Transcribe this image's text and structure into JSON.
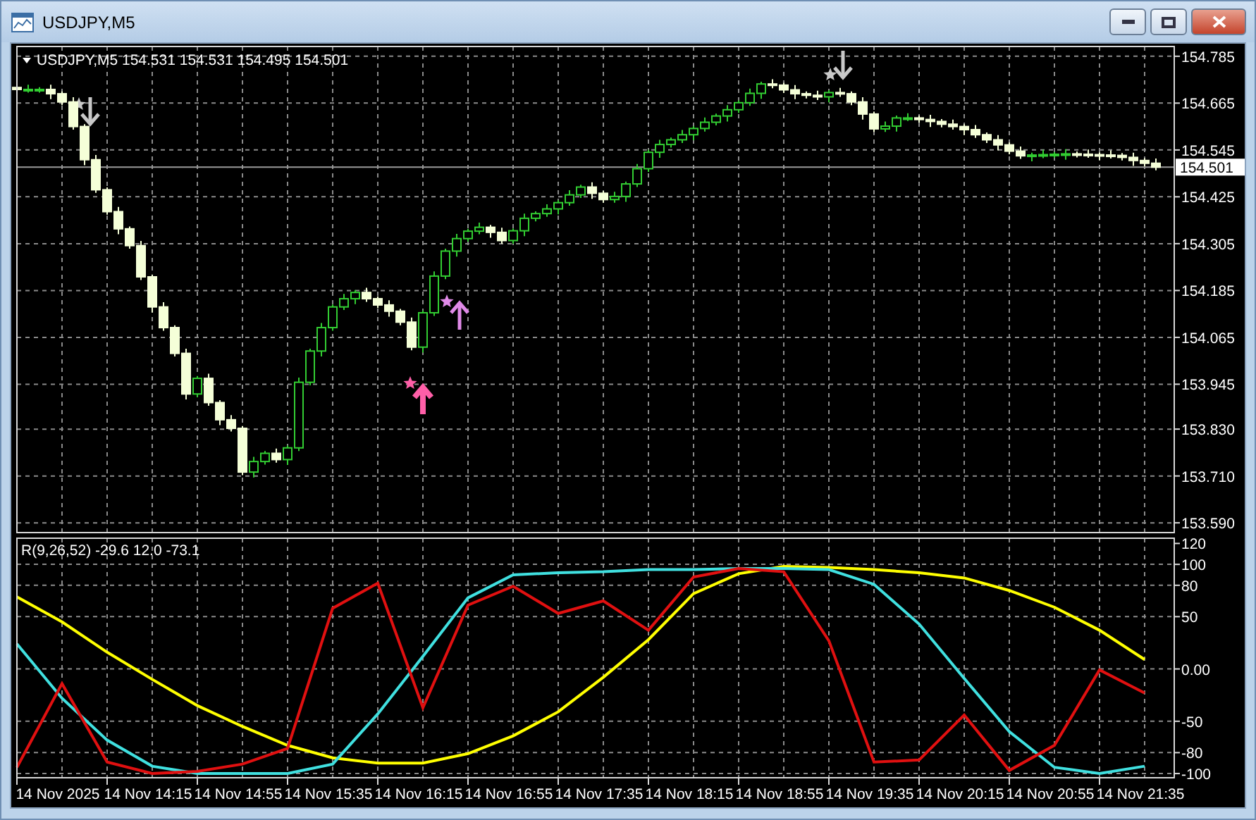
{
  "window": {
    "title": "USDJPY,M5"
  },
  "main_chart": {
    "header": "USDJPY,M5  154.531 154.531 154.495 154.501",
    "chart_data": {
      "type": "candlestick",
      "categories": [
        null,
        null,
        null,
        null,
        null,
        null,
        null,
        null,
        null,
        null,
        null,
        null,
        null,
        null,
        null,
        null,
        null,
        null,
        null,
        null,
        null,
        null,
        null,
        null,
        null,
        null,
        null,
        null,
        null,
        null,
        null,
        null,
        null,
        null,
        null,
        null,
        null,
        null,
        null,
        null,
        null,
        null,
        null,
        null,
        null,
        null,
        null,
        null,
        null,
        null,
        null,
        null,
        null,
        null,
        null,
        null,
        null,
        null,
        null,
        null,
        null,
        null,
        null,
        null,
        null,
        null,
        null,
        null,
        null,
        null,
        null,
        null,
        null,
        null,
        null,
        null,
        null,
        null,
        null,
        null,
        null,
        null,
        null,
        null,
        null,
        null,
        null,
        null,
        null,
        null,
        null,
        null,
        null,
        null,
        null,
        null,
        null,
        null,
        null,
        null,
        null,
        null
      ],
      "ref_lines": [
        {
          "axis": "y",
          "value": 154.501,
          "label": "154.501"
        }
      ],
      "ohlc": [
        [
          154.705,
          154.711,
          154.686,
          154.7
        ],
        [
          154.7,
          154.712,
          154.692,
          154.7
        ],
        [
          154.7,
          154.706,
          154.692,
          154.7
        ],
        [
          154.7,
          154.712,
          154.675,
          154.689
        ],
        [
          154.689,
          154.695,
          154.66,
          154.668
        ],
        [
          154.668,
          154.68,
          154.597,
          154.605
        ],
        [
          154.605,
          154.611,
          154.506,
          154.52
        ],
        [
          154.52,
          154.532,
          154.435,
          154.443
        ],
        [
          154.443,
          154.449,
          154.379,
          154.387
        ],
        [
          154.387,
          154.399,
          154.329,
          154.343
        ],
        [
          154.343,
          154.349,
          154.292,
          154.3
        ],
        [
          154.3,
          154.312,
          154.212,
          154.22
        ],
        [
          154.22,
          154.226,
          154.129,
          154.143
        ],
        [
          154.143,
          154.155,
          154.082,
          154.09
        ],
        [
          154.09,
          154.096,
          154.016,
          154.024
        ],
        [
          154.024,
          154.036,
          153.906,
          153.92
        ],
        [
          153.92,
          153.966,
          153.912,
          153.96
        ],
        [
          153.96,
          153.972,
          153.89,
          153.898
        ],
        [
          153.898,
          153.904,
          153.84,
          153.854
        ],
        [
          153.854,
          153.866,
          153.824,
          153.832
        ],
        [
          153.832,
          153.838,
          153.712,
          153.72
        ],
        [
          153.72,
          153.759,
          153.706,
          153.747
        ],
        [
          153.747,
          153.774,
          153.739,
          153.768
        ],
        [
          153.768,
          153.78,
          153.744,
          153.752
        ],
        [
          153.752,
          153.788,
          153.738,
          153.782
        ],
        [
          153.782,
          153.962,
          153.774,
          153.95
        ],
        [
          153.95,
          154.036,
          153.942,
          154.03
        ],
        [
          154.03,
          154.102,
          154.016,
          154.09
        ],
        [
          154.09,
          154.149,
          154.082,
          154.143
        ],
        [
          154.143,
          154.176,
          154.135,
          154.164
        ],
        [
          154.164,
          154.186,
          154.15,
          154.18
        ],
        [
          154.18,
          154.192,
          154.156,
          154.164
        ],
        [
          154.164,
          154.17,
          154.14,
          154.148
        ],
        [
          154.148,
          154.16,
          154.118,
          154.132
        ],
        [
          154.132,
          154.138,
          154.096,
          154.104
        ],
        [
          154.104,
          154.116,
          154.032,
          154.04
        ],
        [
          154.04,
          154.134,
          154.026,
          154.128
        ],
        [
          154.128,
          154.234,
          154.12,
          154.222
        ],
        [
          154.222,
          154.292,
          154.214,
          154.286
        ],
        [
          154.286,
          154.33,
          154.272,
          154.318
        ],
        [
          154.318,
          154.343,
          154.31,
          154.337
        ],
        [
          154.337,
          154.359,
          154.329,
          154.347
        ],
        [
          154.347,
          154.353,
          154.32,
          154.334
        ],
        [
          154.334,
          154.346,
          154.305,
          154.313
        ],
        [
          154.313,
          154.344,
          154.305,
          154.338
        ],
        [
          154.338,
          154.382,
          154.324,
          154.37
        ],
        [
          154.37,
          154.388,
          154.362,
          154.382
        ],
        [
          154.382,
          154.406,
          154.374,
          154.394
        ],
        [
          154.394,
          154.416,
          154.38,
          154.41
        ],
        [
          154.41,
          154.442,
          154.402,
          154.43
        ],
        [
          154.43,
          154.456,
          154.422,
          154.45
        ],
        [
          154.45,
          154.462,
          154.42,
          154.434
        ],
        [
          154.434,
          154.44,
          154.41,
          154.418
        ],
        [
          154.418,
          154.438,
          154.41,
          154.426
        ],
        [
          154.426,
          154.464,
          154.412,
          154.458
        ],
        [
          154.458,
          154.509,
          154.45,
          154.497
        ],
        [
          154.497,
          154.545,
          154.489,
          154.539
        ],
        [
          154.539,
          154.571,
          154.525,
          154.559
        ],
        [
          154.559,
          154.577,
          154.551,
          154.571
        ],
        [
          154.571,
          154.596,
          154.563,
          154.584
        ],
        [
          154.584,
          154.606,
          154.57,
          154.6
        ],
        [
          154.6,
          154.628,
          154.592,
          154.616
        ],
        [
          154.616,
          154.638,
          154.608,
          154.632
        ],
        [
          154.632,
          154.66,
          154.618,
          154.648
        ],
        [
          154.648,
          154.672,
          154.64,
          154.666
        ],
        [
          154.666,
          154.702,
          154.658,
          154.69
        ],
        [
          154.69,
          154.72,
          154.676,
          154.714
        ],
        [
          154.714,
          154.726,
          154.703,
          154.711
        ],
        [
          154.711,
          154.717,
          154.691,
          154.699
        ],
        [
          154.699,
          154.711,
          154.675,
          154.689
        ],
        [
          154.689,
          154.695,
          154.677,
          154.685
        ],
        [
          154.685,
          154.697,
          154.673,
          154.681
        ],
        [
          154.681,
          154.698,
          154.667,
          154.692
        ],
        [
          154.692,
          154.704,
          154.681,
          154.689
        ],
        [
          154.689,
          154.695,
          154.66,
          154.668
        ],
        [
          154.668,
          154.68,
          154.623,
          154.637
        ],
        [
          154.637,
          154.643,
          154.591,
          154.599
        ],
        [
          154.599,
          154.618,
          154.591,
          154.606
        ],
        [
          154.606,
          154.633,
          154.592,
          154.627
        ],
        [
          154.627,
          154.639,
          154.619,
          154.627
        ],
        [
          154.627,
          154.633,
          154.615,
          154.623
        ],
        [
          154.623,
          154.635,
          154.604,
          154.618
        ],
        [
          154.618,
          154.624,
          154.603,
          154.611
        ],
        [
          154.611,
          154.623,
          154.597,
          154.605
        ],
        [
          154.605,
          154.611,
          154.583,
          154.597
        ],
        [
          154.597,
          154.609,
          154.576,
          154.584
        ],
        [
          154.584,
          154.59,
          154.563,
          154.571
        ],
        [
          154.571,
          154.583,
          154.544,
          154.558
        ],
        [
          154.558,
          154.564,
          154.534,
          154.542
        ],
        [
          154.542,
          154.554,
          154.522,
          154.53
        ],
        [
          154.53,
          154.538,
          154.516,
          154.532
        ],
        [
          154.532,
          154.545,
          154.524,
          154.533
        ],
        [
          154.533,
          154.54,
          154.525,
          154.534
        ],
        [
          154.534,
          154.547,
          154.52,
          154.535
        ],
        [
          154.535,
          154.541,
          154.526,
          154.534
        ],
        [
          154.534,
          154.546,
          154.525,
          154.533
        ],
        [
          154.533,
          154.539,
          154.519,
          154.532
        ],
        [
          154.532,
          154.544,
          154.523,
          154.531
        ],
        [
          154.531,
          154.537,
          154.518,
          154.526
        ],
        [
          154.526,
          154.538,
          154.504,
          154.518
        ],
        [
          154.518,
          154.524,
          154.503,
          154.511
        ],
        [
          154.511,
          154.523,
          154.493,
          154.501
        ]
      ],
      "grid": true,
      "ylim": [
        153.565,
        154.81
      ],
      "yticks": [
        {
          "value": 154.785,
          "label": "154.785"
        },
        {
          "value": 154.665,
          "label": "154.665"
        },
        {
          "value": 154.545,
          "label": "154.545"
        },
        {
          "value": 154.425,
          "label": "154.425"
        },
        {
          "value": 154.305,
          "label": "154.305"
        },
        {
          "value": 154.185,
          "label": "154.185"
        },
        {
          "value": 154.065,
          "label": "154.065"
        },
        {
          "value": 153.945,
          "label": "153.945"
        },
        {
          "value": 153.83,
          "label": "153.830"
        },
        {
          "value": 153.71,
          "label": "153.710"
        },
        {
          "value": 153.59,
          "label": "153.590"
        }
      ]
    }
  },
  "indicator": {
    "header": "R(9,26,52) -29.6 12.0 -73.1",
    "chart_data": {
      "type": "line",
      "categories": [
        null,
        "14 Nov 2025",
        null,
        "14 Nov 14:15",
        null,
        "14 Nov 14:55",
        null,
        "14 Nov 15:35",
        null,
        "14 Nov 16:15",
        null,
        "14 Nov 16:55",
        null,
        "14 Nov 17:35",
        null,
        "14 Nov 18:15",
        null,
        "14 Nov 18:55",
        null,
        "14 Nov 19:35",
        null,
        "14 Nov 20:15",
        null,
        "14 Nov 20:55",
        null,
        "14 Nov 21:35"
      ],
      "series": [
        {
          "color": "#ffff00",
          "values": [
            69,
            45,
            16,
            -10,
            -35,
            -55,
            -73,
            -85,
            -90,
            -90,
            -81,
            -64,
            -41,
            -8,
            28,
            72,
            91,
            98,
            97,
            95,
            92,
            87,
            75,
            59,
            37,
            9
          ]
        },
        {
          "color": "#40e0e0",
          "values": [
            24,
            -28,
            -68,
            -93,
            -100,
            -100,
            -100,
            -91,
            -43,
            12,
            68,
            90,
            92,
            93,
            95,
            95,
            96,
            96,
            95,
            81,
            43,
            -9,
            -60,
            -94,
            -100,
            -93
          ]
        },
        {
          "color": "#e01010",
          "values": [
            -94,
            -14,
            -89,
            -100,
            -98,
            -91,
            -76,
            58,
            82,
            -37,
            61,
            79,
            53,
            65,
            37,
            88,
            96,
            93,
            27,
            -89,
            -87,
            -44,
            -97,
            -73,
            -1,
            -23
          ]
        }
      ],
      "grid": true,
      "ylim": [
        -104,
        125
      ],
      "yticks": [
        120,
        100,
        80,
        50,
        {
          "value": 0,
          "label": "0.00"
        },
        -50,
        -80,
        -100
      ]
    }
  }
}
